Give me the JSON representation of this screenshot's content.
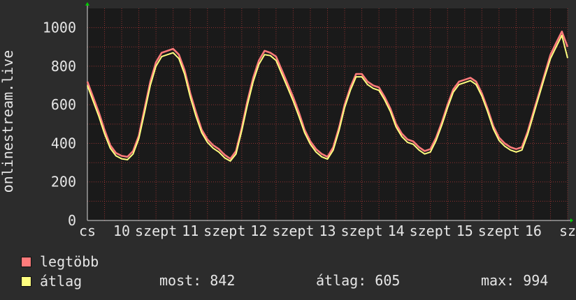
{
  "chart_data": {
    "type": "line",
    "ylabel": "onlinestream.live",
    "ylim": [
      0,
      1100
    ],
    "yticks": [
      0,
      200,
      400,
      600,
      800,
      1000
    ],
    "xticks": [
      {
        "label": "cs",
        "t": 0
      },
      {
        "label": "10",
        "t": 12
      },
      {
        "label": "szept",
        "t": 24
      },
      {
        "label": "11",
        "t": 36
      },
      {
        "label": "szept",
        "t": 48
      },
      {
        "label": "12",
        "t": 60
      },
      {
        "label": "szept",
        "t": 72
      },
      {
        "label": "13",
        "t": 84
      },
      {
        "label": "szept",
        "t": 96
      },
      {
        "label": "14",
        "t": 108
      },
      {
        "label": "szept",
        "t": 120
      },
      {
        "label": "15",
        "t": 132
      },
      {
        "label": "szept",
        "t": 144
      },
      {
        "label": "16",
        "t": 156
      },
      {
        "label": "sz",
        "t": 168
      }
    ],
    "xlim": [
      0,
      168
    ],
    "grid": true,
    "series": [
      {
        "name": "legtöbb",
        "color": "#ff7b7b",
        "points": [
          [
            0,
            720
          ],
          [
            2,
            640
          ],
          [
            4,
            560
          ],
          [
            6,
            470
          ],
          [
            8,
            390
          ],
          [
            10,
            350
          ],
          [
            12,
            335
          ],
          [
            14,
            330
          ],
          [
            16,
            360
          ],
          [
            18,
            440
          ],
          [
            20,
            580
          ],
          [
            22,
            720
          ],
          [
            24,
            820
          ],
          [
            26,
            870
          ],
          [
            28,
            880
          ],
          [
            30,
            890
          ],
          [
            32,
            860
          ],
          [
            34,
            780
          ],
          [
            36,
            660
          ],
          [
            38,
            560
          ],
          [
            40,
            470
          ],
          [
            42,
            420
          ],
          [
            44,
            390
          ],
          [
            46,
            370
          ],
          [
            48,
            340
          ],
          [
            50,
            320
          ],
          [
            52,
            360
          ],
          [
            54,
            480
          ],
          [
            56,
            620
          ],
          [
            58,
            740
          ],
          [
            60,
            830
          ],
          [
            62,
            880
          ],
          [
            64,
            870
          ],
          [
            66,
            850
          ],
          [
            68,
            780
          ],
          [
            70,
            710
          ],
          [
            72,
            640
          ],
          [
            74,
            560
          ],
          [
            76,
            470
          ],
          [
            78,
            410
          ],
          [
            80,
            370
          ],
          [
            82,
            345
          ],
          [
            84,
            330
          ],
          [
            86,
            380
          ],
          [
            88,
            480
          ],
          [
            90,
            600
          ],
          [
            92,
            690
          ],
          [
            94,
            760
          ],
          [
            96,
            760
          ],
          [
            98,
            720
          ],
          [
            100,
            700
          ],
          [
            102,
            690
          ],
          [
            104,
            640
          ],
          [
            106,
            580
          ],
          [
            108,
            500
          ],
          [
            110,
            450
          ],
          [
            112,
            420
          ],
          [
            114,
            410
          ],
          [
            116,
            380
          ],
          [
            118,
            360
          ],
          [
            120,
            370
          ],
          [
            122,
            430
          ],
          [
            124,
            510
          ],
          [
            126,
            600
          ],
          [
            128,
            680
          ],
          [
            130,
            720
          ],
          [
            132,
            730
          ],
          [
            134,
            740
          ],
          [
            136,
            720
          ],
          [
            138,
            660
          ],
          [
            140,
            580
          ],
          [
            142,
            490
          ],
          [
            144,
            430
          ],
          [
            146,
            400
          ],
          [
            148,
            380
          ],
          [
            150,
            370
          ],
          [
            152,
            380
          ],
          [
            154,
            460
          ],
          [
            156,
            560
          ],
          [
            158,
            660
          ],
          [
            160,
            760
          ],
          [
            162,
            860
          ],
          [
            164,
            920
          ],
          [
            166,
            980
          ],
          [
            168,
            900
          ]
        ]
      },
      {
        "name": "átlag",
        "color": "#ffff80",
        "points": [
          [
            0,
            700
          ],
          [
            2,
            620
          ],
          [
            4,
            540
          ],
          [
            6,
            450
          ],
          [
            8,
            375
          ],
          [
            10,
            335
          ],
          [
            12,
            320
          ],
          [
            14,
            315
          ],
          [
            16,
            345
          ],
          [
            18,
            425
          ],
          [
            20,
            560
          ],
          [
            22,
            700
          ],
          [
            24,
            800
          ],
          [
            26,
            850
          ],
          [
            28,
            860
          ],
          [
            30,
            870
          ],
          [
            32,
            840
          ],
          [
            34,
            760
          ],
          [
            36,
            640
          ],
          [
            38,
            540
          ],
          [
            40,
            455
          ],
          [
            42,
            405
          ],
          [
            44,
            375
          ],
          [
            46,
            355
          ],
          [
            48,
            325
          ],
          [
            50,
            308
          ],
          [
            52,
            345
          ],
          [
            54,
            465
          ],
          [
            56,
            600
          ],
          [
            58,
            720
          ],
          [
            60,
            810
          ],
          [
            62,
            860
          ],
          [
            64,
            855
          ],
          [
            66,
            830
          ],
          [
            68,
            760
          ],
          [
            70,
            690
          ],
          [
            72,
            620
          ],
          [
            74,
            540
          ],
          [
            76,
            455
          ],
          [
            78,
            395
          ],
          [
            80,
            355
          ],
          [
            82,
            330
          ],
          [
            84,
            318
          ],
          [
            86,
            365
          ],
          [
            88,
            465
          ],
          [
            90,
            585
          ],
          [
            92,
            675
          ],
          [
            94,
            745
          ],
          [
            96,
            745
          ],
          [
            98,
            705
          ],
          [
            100,
            685
          ],
          [
            102,
            675
          ],
          [
            104,
            625
          ],
          [
            106,
            565
          ],
          [
            108,
            485
          ],
          [
            110,
            435
          ],
          [
            112,
            405
          ],
          [
            114,
            395
          ],
          [
            116,
            365
          ],
          [
            118,
            345
          ],
          [
            120,
            355
          ],
          [
            122,
            415
          ],
          [
            124,
            495
          ],
          [
            126,
            585
          ],
          [
            128,
            665
          ],
          [
            130,
            705
          ],
          [
            132,
            715
          ],
          [
            134,
            725
          ],
          [
            136,
            705
          ],
          [
            138,
            645
          ],
          [
            140,
            565
          ],
          [
            142,
            475
          ],
          [
            144,
            415
          ],
          [
            146,
            385
          ],
          [
            148,
            365
          ],
          [
            150,
            355
          ],
          [
            152,
            365
          ],
          [
            154,
            445
          ],
          [
            156,
            545
          ],
          [
            158,
            645
          ],
          [
            160,
            745
          ],
          [
            162,
            840
          ],
          [
            164,
            900
          ],
          [
            166,
            960
          ],
          [
            168,
            842
          ]
        ]
      }
    ]
  },
  "legend": [
    {
      "label": "legtöbb",
      "color": "#ff7b7b"
    },
    {
      "label": "átlag",
      "color": "#ffff80"
    }
  ],
  "stats": {
    "most": "most: 842",
    "avg": "átlag: 605",
    "max": "max: 994"
  },
  "colors": {
    "background": "#2c2c2c",
    "plot": "#1a1a1a",
    "grid": "#b83a3a",
    "axis_arrow": "#00cc00",
    "text": "#e6e6e6"
  }
}
